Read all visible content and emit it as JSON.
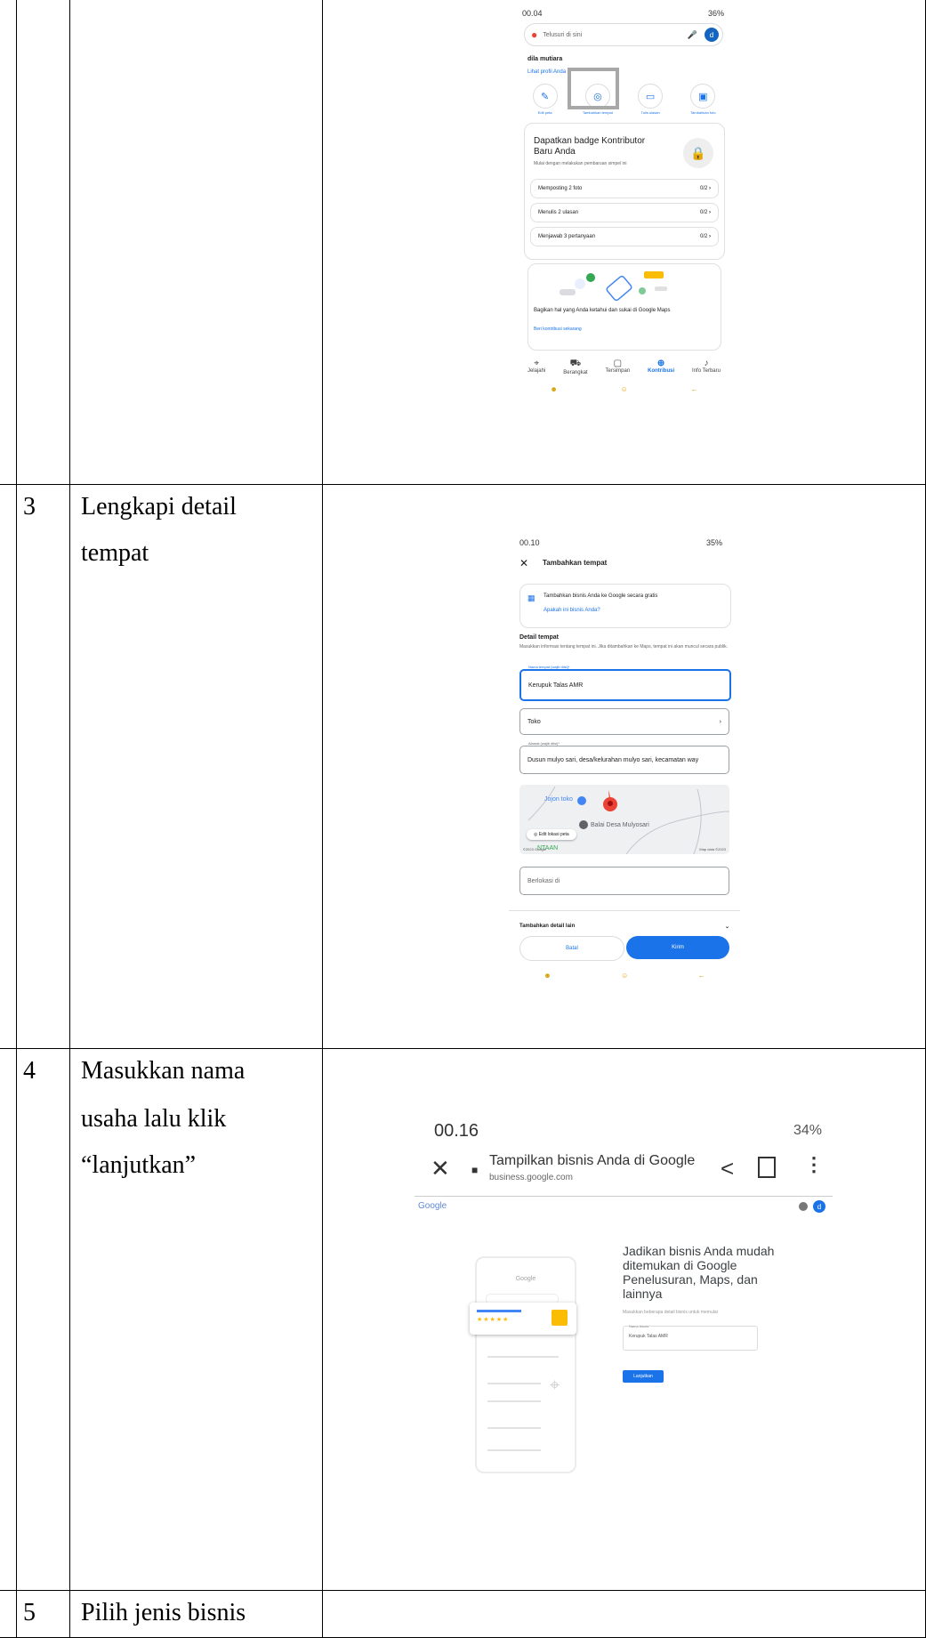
{
  "rows": [
    {
      "number": "3",
      "text_line1": "Lengkapi detail",
      "text_line2": "tempat"
    },
    {
      "number": "4",
      "text_line1": "Masukkan nama",
      "text_line2": "usaha lalu klik",
      "text_line3": "“lanjutkan”"
    },
    {
      "number": "5",
      "text_line1": "Pilih jenis bisnis"
    }
  ],
  "shot1": {
    "status_time": "00.04",
    "status_right": "36%",
    "search_placeholder": "Telusuri di sini",
    "avatar_letter": "d",
    "user_name": "dila mutiara",
    "profile_link": "Lihat profil Anda",
    "actions": [
      "Edit peta",
      "Tambahkan tempat",
      "Tulis ulasan",
      "Tambahkan foto"
    ],
    "badge_title": "Dapatkan badge Kontributor Baru Anda",
    "badge_sub": "Mulai dengan melakukan pembaruan simpel ini",
    "tasks": [
      {
        "label": "Memposting 2 foto",
        "progress": "0/2"
      },
      {
        "label": "Menulis 2 ulasan",
        "progress": "0/2"
      },
      {
        "label": "Menjawab 3 pertanyaan",
        "progress": "0/2"
      }
    ],
    "share_text": "Bagikan hal yang Anda ketahui dan sukai di Google Maps",
    "share_link": "Beri kontribusi sekarang",
    "nav": [
      "Jelajahi",
      "Berangkat",
      "Tersimpan",
      "Kontribusi",
      "Info Terbaru"
    ]
  },
  "shot2": {
    "status_time": "00.10",
    "status_right": "35%",
    "title": "Tambahkan tempat",
    "promo_text": "Tambahkan bisnis Anda ke Google secara gratis",
    "promo_link": "Apakah ini bisnis Anda?",
    "section_title": "Detail tempat",
    "section_desc": "Masukkan informasi tentang tempat ini. Jika ditambahkan ke Maps, tempat ini akan muncul secara publik.",
    "name_label": "Nama tempat (wajib diisi)*",
    "name_value": "Kerupuk Talas AMR",
    "category_value": "Toko",
    "address_label": "Alamat (wajib diisi)*",
    "address_value": "Dusun mulyo sari, desa/kelurahan mulyo sari, kecamatan way",
    "map_label1": "Jojon toko",
    "map_label2": "Balai Desa Mulyosari",
    "map_label3": "NTAAN",
    "map_copyright": "©2023 Google",
    "map_data": "Map data ©2023",
    "edit_map": "Edit lokasi peta",
    "located_in": "Berlokasi di",
    "more_details": "Tambahkan detail lain",
    "cancel": "Batal",
    "submit": "Kirim"
  },
  "shot3": {
    "status_time": "00.16",
    "status_right": "34%",
    "page_title": "Tampilkan bisnis Anda di Google",
    "page_url": "business.google.com",
    "google_logo": "Google",
    "illus_logo": "Google",
    "headline": "Jadikan bisnis Anda mudah ditemukan di Google Penelusuran, Maps, dan lainnya",
    "sub": "Masukkan beberapa detail bisnis untuk memulai",
    "field_label": "Nama bisnis*",
    "field_value": "Kerupuk Talas AMR",
    "continue": "Lanjutkan",
    "stars": "★★★★★",
    "avatar_letter": "d"
  },
  "colors": {
    "accent": "#1a73e8",
    "pin": "#ea4335",
    "border": "#000000"
  }
}
